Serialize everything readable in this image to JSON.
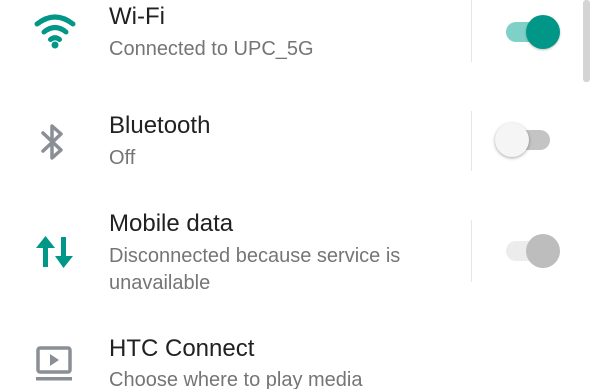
{
  "settings": {
    "wifi": {
      "icon": "wifi-icon",
      "title": "Wi-Fi",
      "subtitle": "Connected to UPC_5G",
      "toggle_state": "on"
    },
    "bluetooth": {
      "icon": "bluetooth-icon",
      "title": "Bluetooth",
      "subtitle": "Off",
      "toggle_state": "off"
    },
    "mobile_data": {
      "icon": "mobile-data-icon",
      "title": "Mobile data",
      "subtitle": "Disconnected because service is unavailable",
      "toggle_state": "disabled"
    },
    "htc_connect": {
      "icon": "cast-icon",
      "title": "HTC Connect",
      "subtitle": "Choose where to play media"
    }
  },
  "colors": {
    "accent": "#009688",
    "accent_track": "#7fd0c6",
    "icon_gray": "#8a8f96",
    "title_text": "#212121",
    "secondary_text": "#757575"
  }
}
